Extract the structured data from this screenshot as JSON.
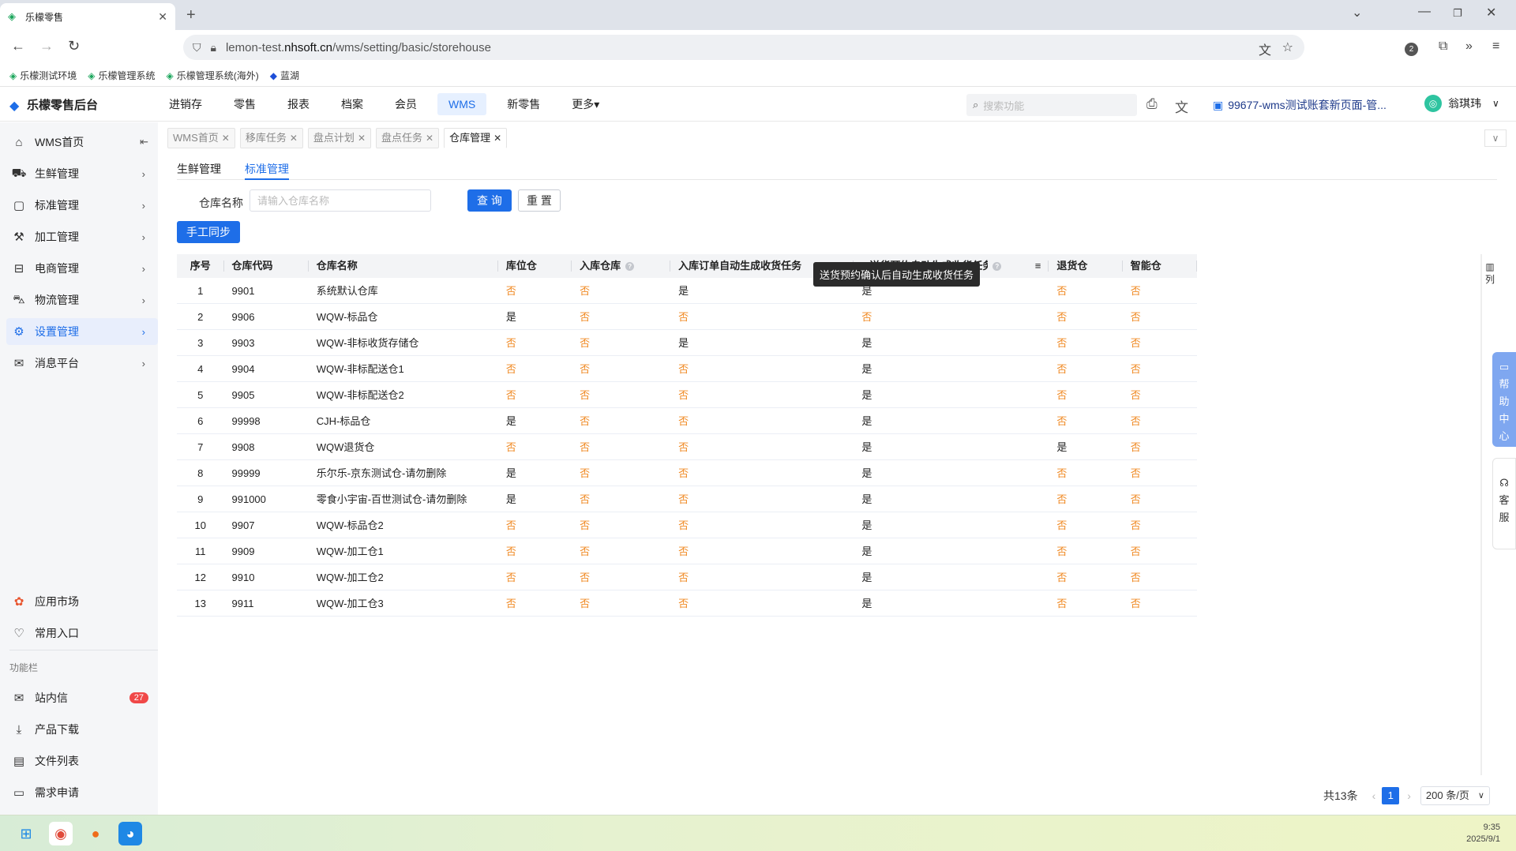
{
  "browser": {
    "tab_title": "乐檬零售",
    "url_prefix": "lemon-test.",
    "url_domain": "nhsoft.cn",
    "url_path": "/wms/setting/basic/storehouse",
    "ext_badge": "2",
    "bookmarks": [
      "乐檬测试环境",
      "乐檬管理系统",
      "乐檬管理系统(海外)",
      "蓝湖"
    ]
  },
  "app": {
    "logo": "乐檬零售后台",
    "nav": [
      "进销存",
      "零售",
      "报表",
      "档案",
      "会员",
      "WMS",
      "新零售",
      "更多"
    ],
    "nav_more_arrow": "▾",
    "search_placeholder": "搜索功能",
    "account": "99677-wms测试账套新页面-管...",
    "user": "翁琪玮"
  },
  "sidebar": {
    "items": [
      {
        "label": "WMS首页",
        "icon": "home-icon"
      },
      {
        "label": "生鲜管理",
        "icon": "basket-icon"
      },
      {
        "label": "标准管理",
        "icon": "box-icon"
      },
      {
        "label": "加工管理",
        "icon": "factory-icon"
      },
      {
        "label": "电商管理",
        "icon": "shop-icon"
      },
      {
        "label": "物流管理",
        "icon": "truck-icon"
      },
      {
        "label": "设置管理",
        "icon": "gear-icon"
      },
      {
        "label": "消息平台",
        "icon": "mail-icon"
      }
    ],
    "bottom": [
      {
        "label": "应用市场",
        "icon": "apps-icon"
      },
      {
        "label": "常用入口",
        "icon": "heart-icon"
      }
    ],
    "section_title": "功能栏",
    "func": [
      {
        "label": "站内信",
        "icon": "inbox-icon",
        "badge": "27"
      },
      {
        "label": "产品下载",
        "icon": "download-icon"
      },
      {
        "label": "文件列表",
        "icon": "file-list-icon"
      },
      {
        "label": "需求申请",
        "icon": "request-icon"
      }
    ]
  },
  "page_tabs": [
    {
      "label": "WMS首页"
    },
    {
      "label": "移库任务"
    },
    {
      "label": "盘点计划"
    },
    {
      "label": "盘点任务"
    },
    {
      "label": "仓库管理",
      "active": true
    }
  ],
  "sub_tabs": [
    "生鲜管理",
    "标准管理"
  ],
  "filter": {
    "label": "仓库名称",
    "placeholder": "请输入仓库名称",
    "query": "查 询",
    "reset": "重 置",
    "sync": "手工同步"
  },
  "table": {
    "headers": [
      "序号",
      "仓库代码",
      "仓库名称",
      "库位仓",
      "入库仓库",
      "入库订单自动生成收货任务",
      "送货预约自动生成收货任务",
      "退货仓",
      "智能仓"
    ],
    "rows": [
      [
        "1",
        "9901",
        "系统默认仓库",
        "否",
        "否",
        "是",
        "是",
        "否",
        "否"
      ],
      [
        "2",
        "9906",
        "WQW-标品仓",
        "是",
        "否",
        "否",
        "否",
        "否",
        "否"
      ],
      [
        "3",
        "9903",
        "WQW-非标收货存储仓",
        "否",
        "否",
        "是",
        "是",
        "否",
        "否"
      ],
      [
        "4",
        "9904",
        "WQW-非标配送仓1",
        "否",
        "否",
        "否",
        "是",
        "否",
        "否"
      ],
      [
        "5",
        "9905",
        "WQW-非标配送仓2",
        "否",
        "否",
        "否",
        "是",
        "否",
        "否"
      ],
      [
        "6",
        "99998",
        "CJH-标品仓",
        "是",
        "否",
        "否",
        "是",
        "否",
        "否"
      ],
      [
        "7",
        "9908",
        "WQW退货仓",
        "否",
        "否",
        "否",
        "是",
        "是",
        "否"
      ],
      [
        "8",
        "99999",
        "乐尔乐-京东测试仓-请勿删除",
        "是",
        "否",
        "否",
        "是",
        "否",
        "否"
      ],
      [
        "9",
        "991000",
        "零食小宇宙-百世测试仓-请勿删除",
        "是",
        "否",
        "否",
        "是",
        "否",
        "否"
      ],
      [
        "10",
        "9907",
        "WQW-标品仓2",
        "否",
        "否",
        "否",
        "是",
        "否",
        "否"
      ],
      [
        "11",
        "9909",
        "WQW-加工仓1",
        "否",
        "否",
        "否",
        "是",
        "否",
        "否"
      ],
      [
        "12",
        "9910",
        "WQW-加工仓2",
        "否",
        "否",
        "否",
        "是",
        "否",
        "否"
      ],
      [
        "13",
        "9911",
        "WQW-加工仓3",
        "否",
        "否",
        "否",
        "是",
        "否",
        "否"
      ]
    ],
    "tooltip": "送货预约确认后自动生成收货任务",
    "column_setting": "列"
  },
  "pagination": {
    "total": "共13条",
    "current": "1",
    "page_size": "200 条/页"
  },
  "dock": {
    "help": "帮助中心",
    "service": "客服"
  },
  "taskbar": {
    "time": "9:35",
    "date": "2025/9/1"
  },
  "colors": {
    "primary": "#1e6ee8",
    "no_value": "#f08a24"
  }
}
